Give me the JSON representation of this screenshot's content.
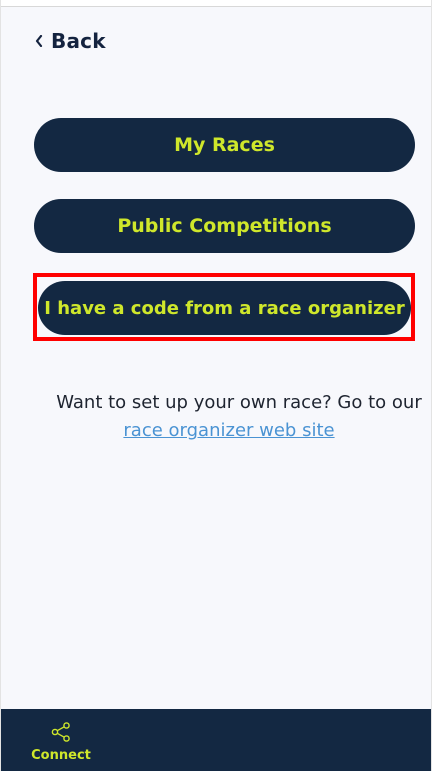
{
  "header": {
    "back_label": "Back"
  },
  "menu": {
    "my_races_label": "My Races",
    "public_competitions_label": "Public Competitions",
    "code_label": "I have a code from a race organizer"
  },
  "promo": {
    "text": "Want to set up your own race? Go to our",
    "link_text": "race organizer web site"
  },
  "bottom_nav": {
    "connect_label": "Connect"
  },
  "icons": {
    "back": "chevron-left-icon",
    "connect": "share-icon"
  },
  "colors": {
    "primary_navy": "#132842",
    "accent_lime": "#cfe72b",
    "background": "#f7f8fc",
    "link_blue": "#4a93d3",
    "highlight_red": "#ff0000"
  }
}
